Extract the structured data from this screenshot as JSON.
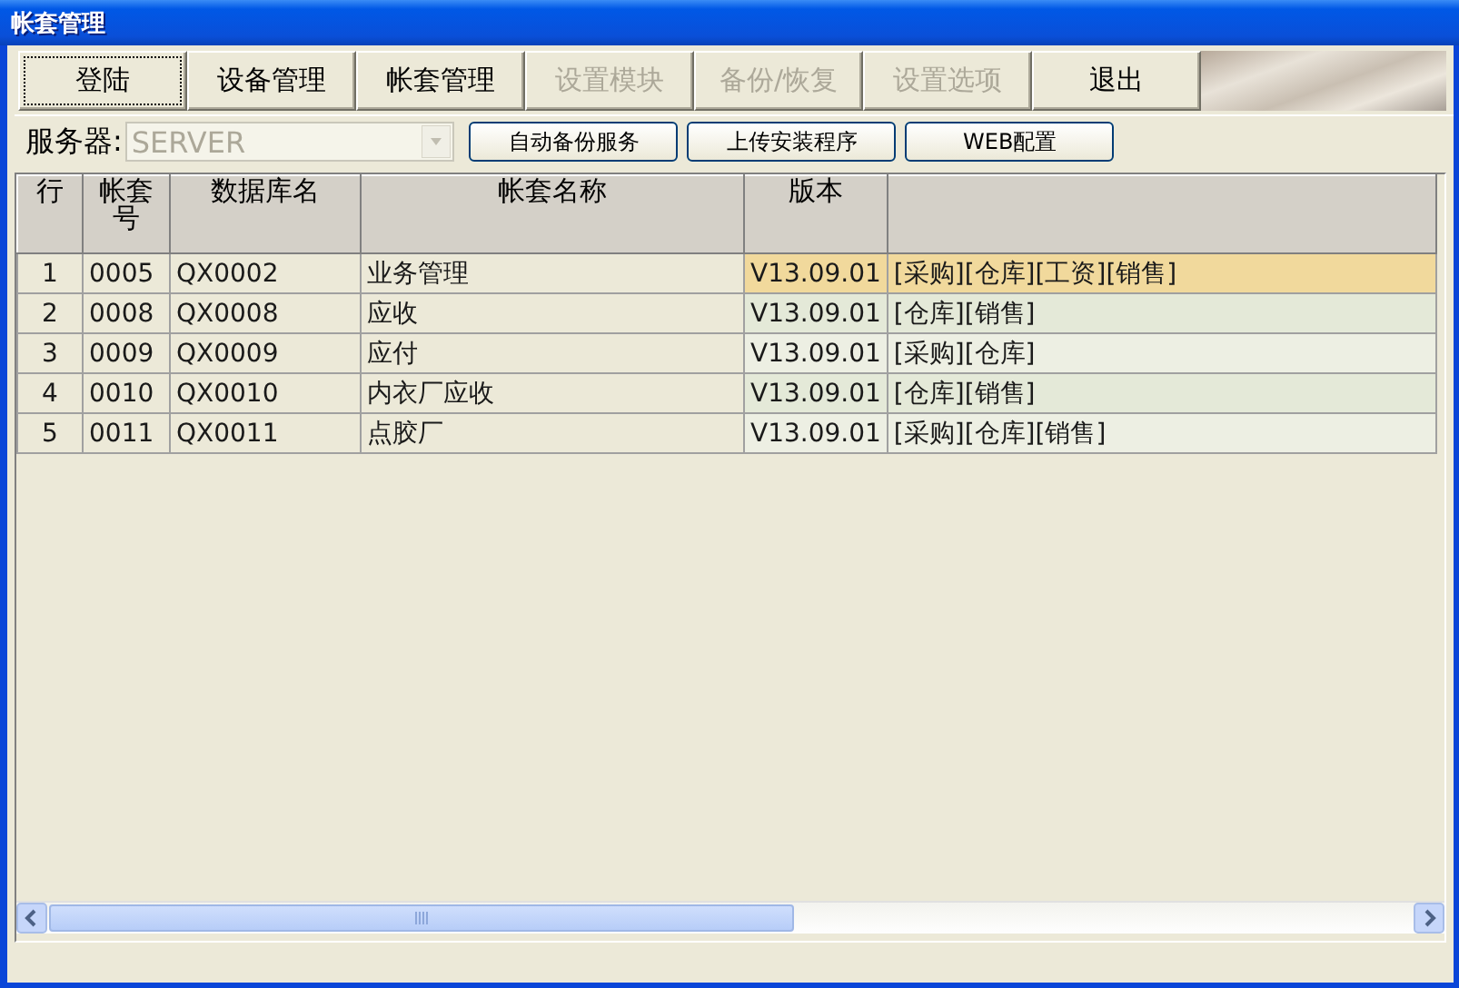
{
  "window": {
    "title": "帐套管理"
  },
  "toolbar": [
    {
      "label": "登陆",
      "disabled": false,
      "focused": true
    },
    {
      "label": "设备管理",
      "disabled": false,
      "focused": false
    },
    {
      "label": "帐套管理",
      "disabled": false,
      "focused": false
    },
    {
      "label": "设置模块",
      "disabled": true,
      "focused": false
    },
    {
      "label": "备份/恢复",
      "disabled": true,
      "focused": false
    },
    {
      "label": "设置选项",
      "disabled": true,
      "focused": false
    },
    {
      "label": "退出",
      "disabled": false,
      "focused": false
    }
  ],
  "server": {
    "label": "服务器:",
    "value": "SERVER",
    "disabled": true
  },
  "actions": [
    "自动备份服务",
    "上传安装程序",
    "WEB配置"
  ],
  "table": {
    "columns": [
      "行",
      "帐套号",
      "数据库名",
      "帐套名称",
      "版本"
    ],
    "rows": [
      {
        "cells": [
          "1",
          "0005",
          "QX0002",
          "业务管理",
          "V13.09.01",
          "[采购][仓库][工资][销售]"
        ],
        "selected": true
      },
      {
        "cells": [
          "2",
          "0008",
          "QX0008",
          "应收",
          "V13.09.01",
          "[仓库][销售]"
        ],
        "selected": false
      },
      {
        "cells": [
          "3",
          "0009",
          "QX0009",
          "应付",
          "V13.09.01",
          "[采购][仓库]"
        ],
        "selected": false
      },
      {
        "cells": [
          "4",
          "0010",
          "QX0010",
          "内衣厂应收",
          "V13.09.01",
          "[仓库][销售]"
        ],
        "selected": false
      },
      {
        "cells": [
          "5",
          "0011",
          "QX0011",
          "点胶厂",
          "V13.09.01",
          "[采购][仓库][销售]"
        ],
        "selected": false
      }
    ]
  }
}
